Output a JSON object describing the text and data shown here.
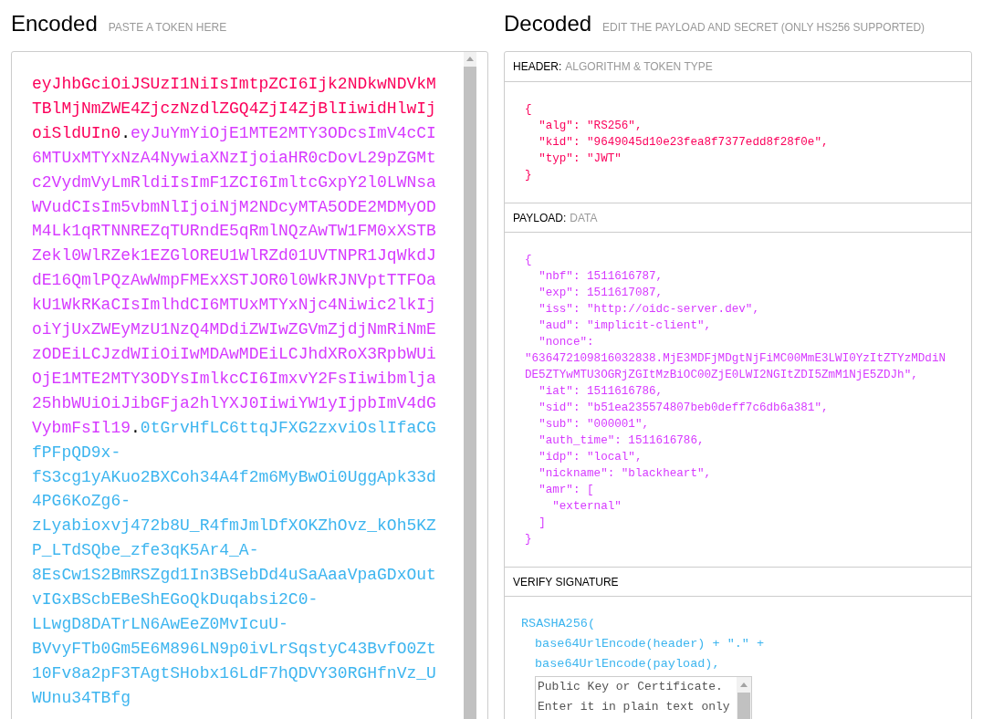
{
  "encoded": {
    "title": "Encoded",
    "hint": "PASTE A TOKEN HERE",
    "token": [
      {
        "kind": "header",
        "text": "eyJhbGciOiJSUzI1NiIsImtpZCI6Ijk2NDkwNDVkMTBlMjNmZWE4ZjczNzdlZGQ4ZjI4ZjBlIiwidHlwIjoiSldUIn0"
      },
      {
        "kind": "dot",
        "text": "."
      },
      {
        "kind": "payload",
        "text": "eyJuYmYiOjE1MTE2MTY3ODcsImV4cCI6MTUxMTYxNzA4NywiaXNzIjoiaHR0cDovL29pZGMtc2VydmVyLmRldiIsImF1ZCI6ImltcGxpY2l0LWNsaWVudCIsIm5vbmNlIjoiNjM2NDcyMTA5ODE2MDMyODM4Lk1qRTNNREZqTURndE5qRmlNQzAwTW1FM0xXSTBZekl0WlRZek1EZGlOREU1WlRZd01UVTNPR1JqWkdJdE16QmlPQzAwWmpFMExXSTJOR0l0WkRJNVptTTFOakU1WkRKaCIsImlhdCI6MTUxMTYxNjc4Niwic2lkIjoiYjUxZWEyMzU1NzQ4MDdiZWIwZGVmZjdjNmRiNmEzODEiLCJzdWIiOiIwMDAwMDEiLCJhdXRoX3RpbWUiOjE1MTE2MTY3ODYsImlkcCI6ImxvY2FsIiwibmlja25hbWUiOiJibGFja2hlYXJ0IiwiYW1yIjpbImV4dGVybmFsIl19"
      },
      {
        "kind": "dot",
        "text": "."
      },
      {
        "kind": "signature",
        "text": "0tGrvHfLC6ttqJFXG2zxviOslIfaCGfPFpQD9x-fS3cg1yAKuo2BXCoh34A4f2m6MyBwOi0UggApk33d4PG6KoZg6-zLyabioxvj472b8U_R4fmJmlDfXOKZhOvz_kOh5KZP_LTdSQbe_zfe3qK5Ar4_A-8EsCw1S2BmRSZgd1In3BSebDd4uSaAaaVpaGDxOutvIGxBScbEBeShEGoQkDuqabsi2C0-LLwgD8DATrLN6AwEeZ0MvIcuU-BVvyFTb0Gm5E6M896LN9p0ivLrSqstyC43BvfO0Zt10Fv8a2pF3TAgtSHobx16LdF7hQDVY30RGHfnVz_UWUnu34TBfg"
      }
    ]
  },
  "decoded": {
    "title": "Decoded",
    "hint": "EDIT THE PAYLOAD AND SECRET (ONLY HS256 SUPPORTED)",
    "sections": [
      {
        "kind": "header",
        "label": "HEADER:",
        "sublabel": "ALGORITHM & TOKEN TYPE",
        "code": "{\n  \"alg\": \"RS256\",\n  \"kid\": \"9649045d10e23fea8f7377edd8f28f0e\",\n  \"typ\": \"JWT\"\n}"
      },
      {
        "kind": "payload",
        "label": "PAYLOAD:",
        "sublabel": "DATA",
        "code": "{\n  \"nbf\": 1511616787,\n  \"exp\": 1511617087,\n  \"iss\": \"http://oidc-server.dev\",\n  \"aud\": \"implicit-client\",\n  \"nonce\":\n\"636472109816032838.MjE3MDFjMDgtNjFiMC00MmE3LWI0YzItZTYzMDdiNDE5ZTYwMTU3OGRjZGItMzBiOC00ZjE0LWI2NGItZDI5ZmM1NjE5ZDJh\",\n  \"iat\": 1511616786,\n  \"sid\": \"b51ea235574807beb0deff7c6db6a381\",\n  \"sub\": \"000001\",\n  \"auth_time\": 1511616786,\n  \"idp\": \"local\",\n  \"nickname\": \"blackheart\",\n  \"amr\": [\n    \"external\"\n  ]\n}"
      },
      {
        "kind": "verify",
        "label": "VERIFY SIGNATURE",
        "lines": [
          "RSASHA256(",
          "base64UrlEncode(header) + \".\" +",
          "base64UrlEncode(payload),"
        ],
        "key_field": {
          "placeholder": "Public Key or Certificate. Enter it in plain text only"
        }
      }
    ]
  }
}
